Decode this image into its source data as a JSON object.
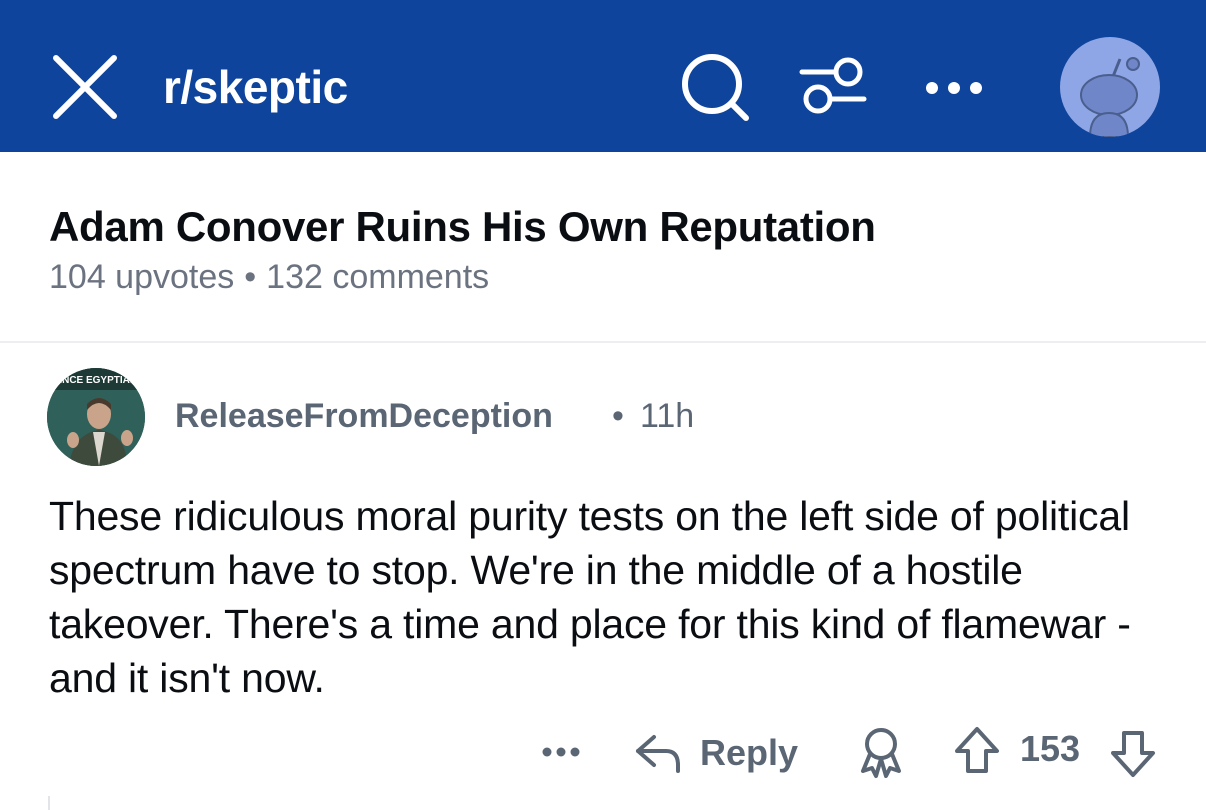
{
  "header": {
    "subreddit": "r/skeptic",
    "background_color": "#0e449b",
    "icons": [
      "close-icon",
      "search-icon",
      "filter-icon",
      "more-icon",
      "avatar-icon"
    ]
  },
  "post": {
    "title": "Adam Conover Ruins His Own Reputation",
    "upvotes": "104 upvotes",
    "separator": "•",
    "comments": "132 comments"
  },
  "comment": {
    "avatar_text": "ANCE EGYPTIAN",
    "author": "ReleaseFromDeception",
    "separator": "•",
    "time": "11h",
    "body": "These ridiculous moral purity tests on the left side of political spectrum have to stop. We're in the middle of a hostile takeover. There's a time and place for this kind of flamewar - and it isn't now.",
    "actions": {
      "reply_label": "Reply",
      "score": "153",
      "icons": [
        "more-icon",
        "reply-icon",
        "award-icon",
        "upvote-icon",
        "downvote-icon"
      ]
    }
  }
}
